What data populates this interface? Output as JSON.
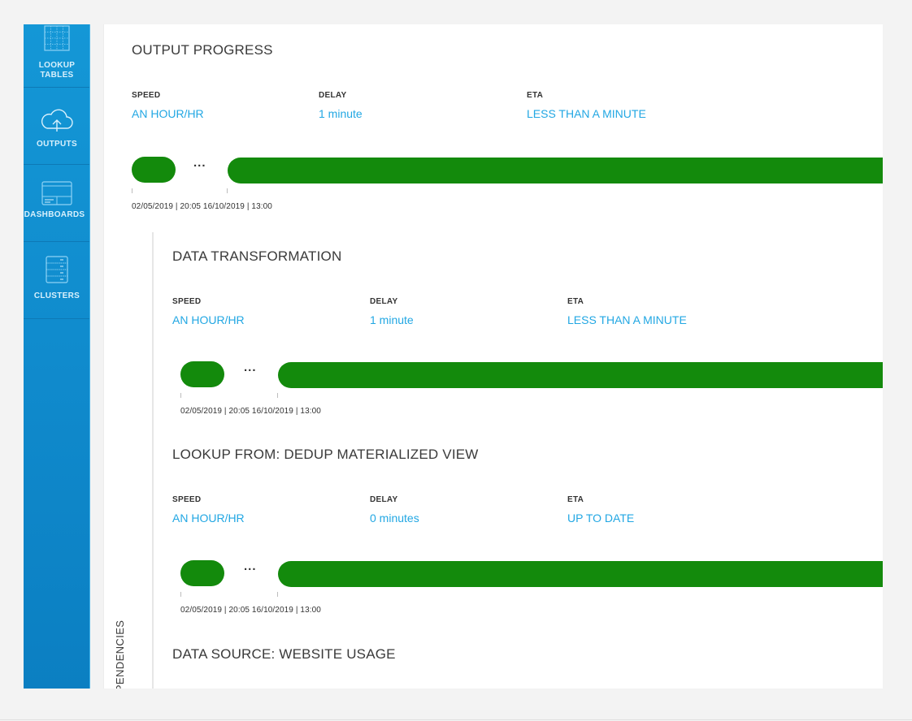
{
  "sidebar": {
    "accent_color": "#1497d6",
    "items": [
      {
        "label_line1": "LOOKUP",
        "label_line2": "TABLES",
        "icon": "grid-table-icon"
      },
      {
        "label_line1": "OUTPUTS",
        "label_line2": "",
        "icon": "cloud-upload-icon"
      },
      {
        "label_line1": "DASHBOARDS",
        "label_line2": "",
        "icon": "dashboard-window-icon"
      },
      {
        "label_line1": "CLUSTERS",
        "label_line2": "",
        "icon": "server-rack-icon"
      }
    ]
  },
  "output_progress": {
    "title": "OUTPUT PROGRESS",
    "speed_label": "SPEED",
    "speed_value": "AN HOUR/HR",
    "delay_label": "DELAY",
    "delay_value": "1  minute",
    "eta_label": "ETA",
    "eta_value": "LESS THAN A MINUTE",
    "ellipsis": "...",
    "timestamps": "02/05/2019 | 20:05 16/10/2019 | 13:00"
  },
  "dependencies": {
    "label": "DEPENDENCIES",
    "items": [
      {
        "title": "DATA TRANSFORMATION",
        "speed_label": "SPEED",
        "speed_value": "AN HOUR/HR",
        "delay_label": "DELAY",
        "delay_value": "1  minute",
        "eta_label": "ETA",
        "eta_value": "LESS THAN A MINUTE",
        "ellipsis": "...",
        "timestamps": "02/05/2019 | 20:05 16/10/2019 | 13:00"
      },
      {
        "title": "LOOKUP FROM: DEDUP MATERIALIZED VIEW",
        "speed_label": "SPEED",
        "speed_value": "AN HOUR/HR",
        "delay_label": "DELAY",
        "delay_value": "0  minutes",
        "eta_label": "ETA",
        "eta_value": "UP TO DATE",
        "ellipsis": "...",
        "timestamps": "02/05/2019 | 20:05 16/10/2019 | 13:00"
      },
      {
        "title": "DATA SOURCE: WEBSITE USAGE"
      }
    ]
  },
  "colors": {
    "progress_green": "#138a0c",
    "value_blue": "#22a7e3"
  }
}
